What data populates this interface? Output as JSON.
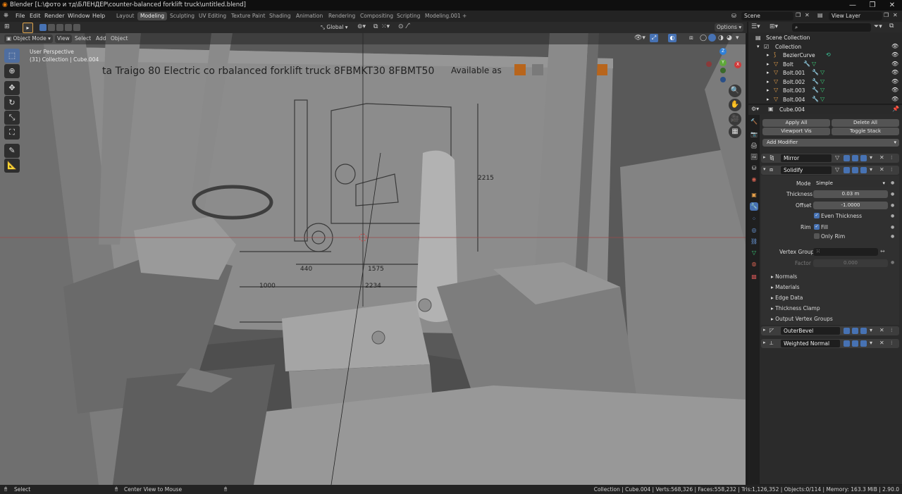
{
  "window": {
    "title": "Blender [L:\\фото и тд\\БЛЕНДЕР\\counter-balanced forklift truck\\untitled.blend]",
    "minimize": "—",
    "maximize": "❐",
    "close": "✕"
  },
  "menu": {
    "items": [
      "File",
      "Edit",
      "Render",
      "Window",
      "Help"
    ],
    "workspaces": [
      "Layout",
      "Modeling",
      "Sculpting",
      "UV Editing",
      "Texture Paint",
      "Shading",
      "Animation",
      "Rendering",
      "Compositing",
      "Scripting",
      "Modeling.001"
    ],
    "active_workspace": "Modeling",
    "add_tab": "+",
    "scene": "Scene",
    "view_layer": "View Layer"
  },
  "viewport_header": {
    "mode": "Object Mode",
    "menus": [
      "View",
      "Select",
      "Add",
      "Object"
    ],
    "orientation": "Global",
    "options": "Options"
  },
  "viewport": {
    "perspective": "User Perspective",
    "collection_info": "(31) Collection | Cube.004",
    "blueprint": {
      "title": "ta Traigo 80 Electric co  rbalanced forklift truck 8FBMKT30 8FBMT50",
      "subtitle": "Available as",
      "dims": [
        "2215",
        "440",
        "1575",
        "1000",
        "2234"
      ]
    },
    "gizmo": {
      "x": "X",
      "y": "Y",
      "z": "Z"
    }
  },
  "outliner": {
    "search_placeholder": "",
    "root": "Scene Collection",
    "collection": "Collection",
    "items": [
      "BezierCurve",
      "Bolt",
      "Bolt.001",
      "Bolt.002",
      "Bolt.003",
      "Bolt.004"
    ]
  },
  "properties": {
    "object_name": "Cube.004",
    "buttons": {
      "apply_all": "Apply All",
      "delete_all": "Delete All",
      "viewport_vis": "Viewport Vis",
      "toggle_stack": "Toggle Stack"
    },
    "add_modifier": "Add Modifier",
    "modifiers": {
      "mirror": "Mirror",
      "solidify": "Solidify",
      "outer_bevel": "OuterBevel",
      "weighted_normal": "Weighted Normal"
    },
    "solidify": {
      "mode_label": "Mode",
      "mode": "Simple",
      "thickness_label": "Thickness",
      "thickness": "0.03 m",
      "offset_label": "Offset",
      "offset": "-1.0000",
      "even_thickness": "Even Thickness",
      "rim_label": "Rim",
      "fill": "Fill",
      "only_rim": "Only Rim",
      "vertex_group_label": "Vertex Group",
      "factor_label": "Factor",
      "factor": "0.000",
      "subpanels": [
        "Normals",
        "Materials",
        "Edge Data",
        "Thickness Clamp",
        "Output Vertex Groups"
      ]
    }
  },
  "statusbar": {
    "left": "Select",
    "middle": "Center View to Mouse",
    "stats": "Collection | Cube.004 | Verts:568,326 | Faces:558,232 | Tris:1,126,352 | Objects:0/114 | Memory: 163.3 MiB | 2.90.0"
  },
  "colors": {
    "accent": "#4772b3",
    "active_tab": "#474747",
    "panel": "#2b2b2b",
    "viewport": "#5a5a5a"
  }
}
